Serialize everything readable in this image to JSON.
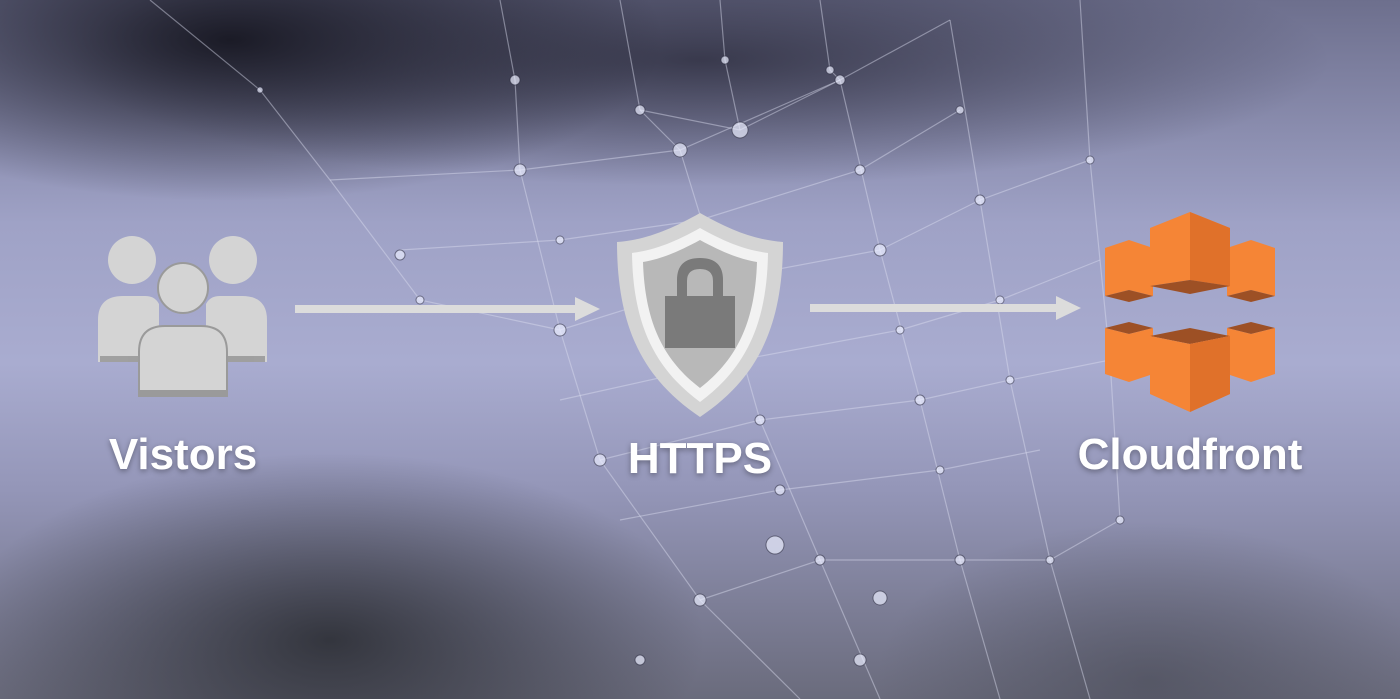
{
  "nodes": [
    {
      "id": "visitors",
      "label": "Vistors",
      "icon": "users-group-icon"
    },
    {
      "id": "https",
      "label": "HTTPS",
      "icon": "shield-lock-icon"
    },
    {
      "id": "cloudfront",
      "label": "Cloudfront",
      "icon": "aws-cloudfront-icon"
    }
  ],
  "colors": {
    "icon_gray": "#d4d4d4",
    "arrow": "#dcdcdc",
    "cloudfront_orange": "#f58536",
    "cloudfront_dark": "#9d5025",
    "label": "#ffffff"
  }
}
